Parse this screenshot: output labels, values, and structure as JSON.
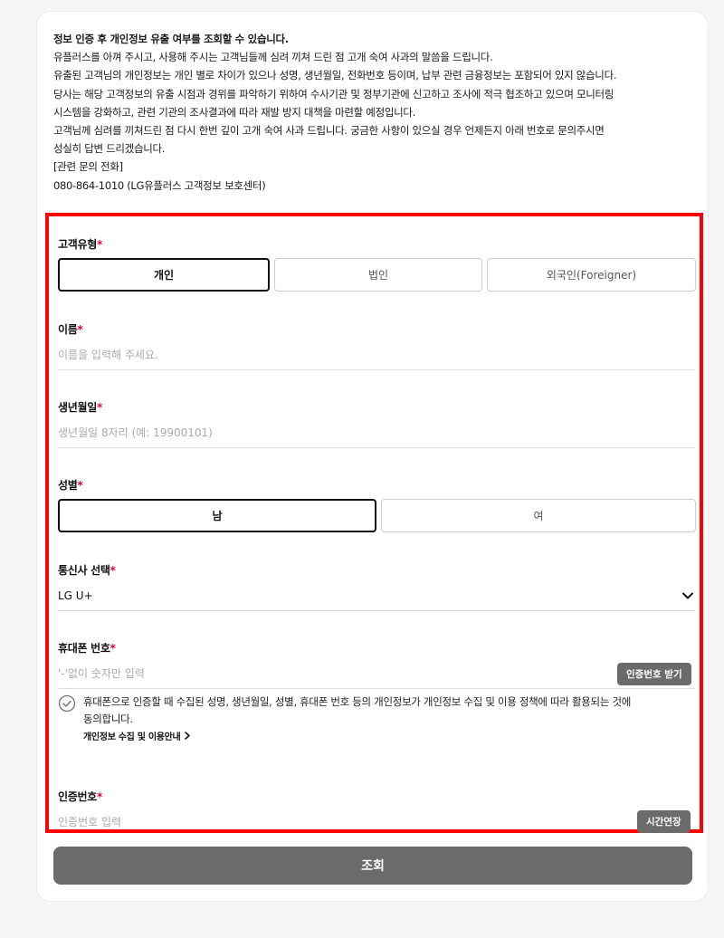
{
  "notice": {
    "lines": [
      "정보 인증 후 개인정보 유출 여부를 조회할 수 있습니다.",
      "유플러스를 아껴 주시고, 사용해 주시는 고객님들께 심려 끼쳐 드린 점 고개 숙여 사과의 말씀을 드립니다.",
      "유출된 고객님의 개인정보는 개인 별로 차이가 있으나 성명, 생년월일, 전화번호 등이며, 납부 관련 금융정보는 포함되어 있지 않습니다.",
      "당사는 해당 고객정보의 유출 시점과 경위를 파악하기 위하여 수사기관 및 정부기관에 신고하고 조사에 적극 협조하고 있으며 모니터링",
      "시스템을 강화하고, 관련 기관의 조사결과에 따라 재발 방지 대책을 마련할 예정입니다.",
      "고객님께 심려를 끼쳐드린 점 다시 한번 깊이 고개 숙여 사과 드립니다. 궁금한 사항이 있으실 경우 언제든지 아래 번호로 문의주시면",
      "성실히 답변 드리겠습니다.",
      "[관련 문의 전화]",
      "080-864-1010 (LG유플러스 고객정보 보호센터)"
    ]
  },
  "form": {
    "customer_type": {
      "label": "고객유형",
      "required_mark": "*",
      "options": [
        "개인",
        "법인",
        "외국인(Foreigner)"
      ],
      "selected": "개인"
    },
    "name": {
      "label": "이름",
      "required_mark": "*",
      "placeholder": "이름을 입력해 주세요.",
      "value": ""
    },
    "birth": {
      "label": "생년월일",
      "required_mark": "*",
      "placeholder": "생년월일 8자리 (예: 19900101)",
      "value": ""
    },
    "gender": {
      "label": "성별",
      "required_mark": "*",
      "options": [
        "남",
        "여"
      ],
      "selected": "남"
    },
    "carrier": {
      "label": "통신사 선택",
      "required_mark": "*",
      "value": "LG U+",
      "icon": "chevron-down-icon"
    },
    "phone": {
      "label": "휴대폰 번호",
      "required_mark": "*",
      "placeholder": "'-'없이 숫자만 입력",
      "value": "",
      "button": "인증번호 받기"
    },
    "consent": {
      "icon": "check-circle-icon",
      "text_line1": "휴대폰으로 인증할 때 수집된 성명, 생년월일, 성별, 휴대폰 번호 등의 개인정보가 개인정보 수집 및 이용 정책에 따라 활용되는 것에",
      "text_line2": "동의합니다.",
      "link": "개인정보 수집 및 이용안내",
      "link_icon": "chevron-right-icon"
    },
    "auth_code": {
      "label": "인증번호",
      "required_mark": "*",
      "placeholder": "인증번호 입력",
      "value": "",
      "button": "시간연장"
    }
  },
  "submit_label": "조회",
  "colors": {
    "highlight_border": "#ff0000",
    "required": "#e4003c",
    "button_gray": "#6b6b6b"
  }
}
